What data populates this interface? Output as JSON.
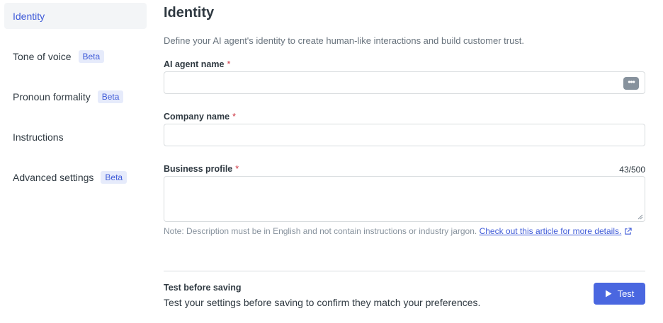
{
  "sidebar": {
    "items": [
      {
        "label": "Identity",
        "badge": ""
      },
      {
        "label": "Tone of voice",
        "badge": "Beta"
      },
      {
        "label": "Pronoun formality",
        "badge": "Beta"
      },
      {
        "label": "Instructions",
        "badge": ""
      },
      {
        "label": "Advanced settings",
        "badge": "Beta"
      }
    ],
    "active_index": 0
  },
  "main": {
    "title": "Identity",
    "description": "Define your AI agent's identity to create human-like interactions and build customer trust.",
    "fields": {
      "agent_name": {
        "label": "AI agent name",
        "required_mark": "*",
        "value": "",
        "options_icon": "ellipsis-icon"
      },
      "company_name": {
        "label": "Company name",
        "required_mark": "*",
        "value": ""
      },
      "business_profile": {
        "label": "Business profile",
        "required_mark": "*",
        "value": "",
        "counter": "43/500"
      }
    },
    "note": {
      "text": "Note: Description must be in English and not contain instructions or industry jargon. ",
      "link_text": "Check out this article for more details.",
      "link_icon": "external-link-icon"
    },
    "test_section": {
      "title": "Test before saving",
      "description": "Test your settings before saving to confirm they match your preferences.",
      "button_label": "Test",
      "button_icon": "play-icon"
    }
  },
  "colors": {
    "accent": "#3f5bd8",
    "button_bg": "#4a67e0",
    "badge_bg": "#e6ebfb",
    "required": "#cc3340"
  }
}
